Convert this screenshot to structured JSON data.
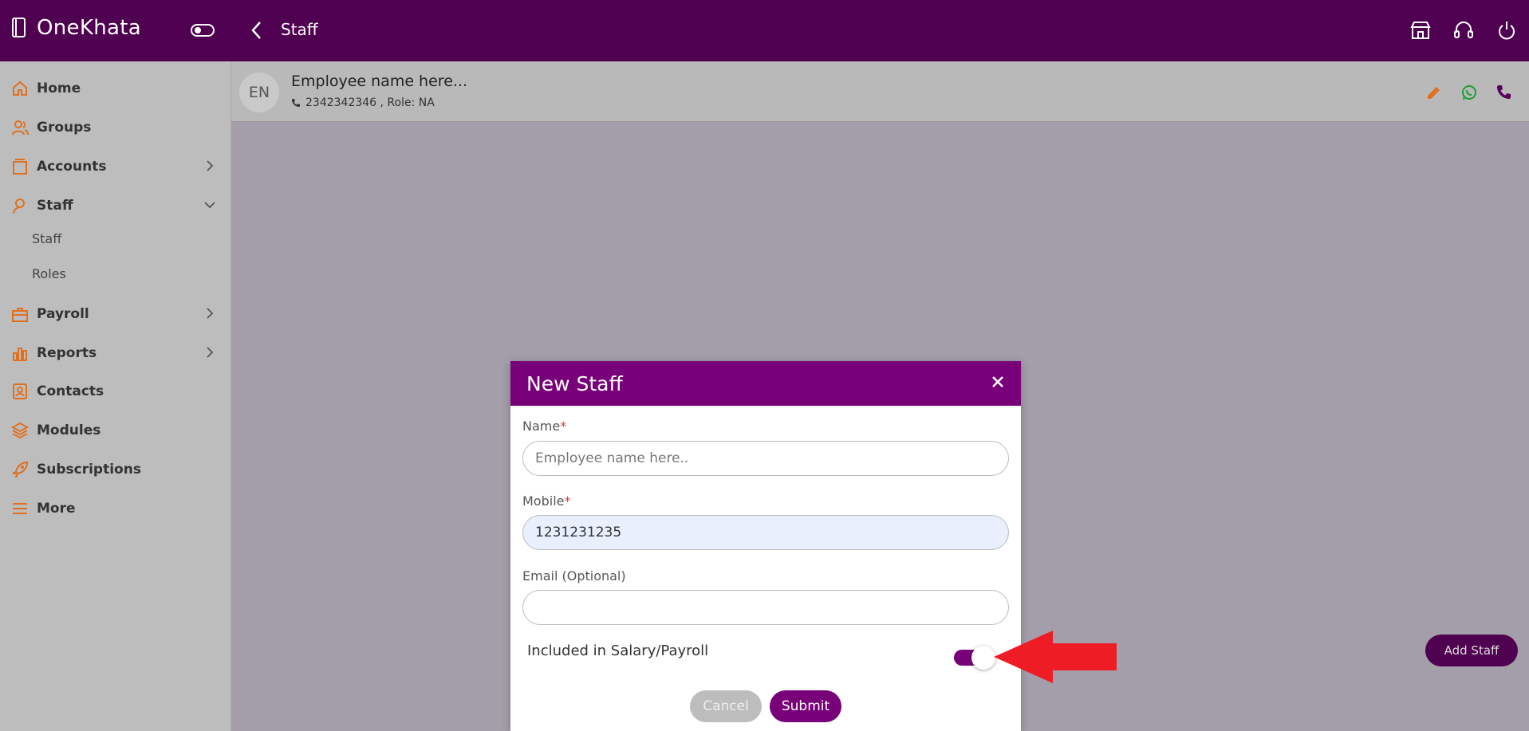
{
  "app": {
    "brand": "OneKhata",
    "page_title": "Staff"
  },
  "sidebar": {
    "items": [
      {
        "label": "Home",
        "icon": "home-icon"
      },
      {
        "label": "Groups",
        "icon": "groups-icon"
      },
      {
        "label": "Accounts",
        "icon": "accounts-icon"
      },
      {
        "label": "Staff",
        "icon": "staff-icon"
      },
      {
        "label": "Payroll",
        "icon": "payroll-icon"
      },
      {
        "label": "Reports",
        "icon": "reports-icon"
      },
      {
        "label": "Contacts",
        "icon": "contacts-icon"
      },
      {
        "label": "Modules",
        "icon": "modules-icon"
      },
      {
        "label": "Subscriptions",
        "icon": "rocket-icon"
      },
      {
        "label": "More",
        "icon": "menu-icon"
      }
    ],
    "staff_subitems": [
      "Staff",
      "Roles"
    ]
  },
  "employee": {
    "initials": "EN",
    "name": "Employee name here...",
    "meta": "2342342346 , Role: NA"
  },
  "add_staff_label": "Add Staff",
  "modal": {
    "title": "New Staff",
    "name_label": "Name",
    "name_placeholder": "Employee name here..",
    "mobile_label": "Mobile",
    "mobile_value": "1231231235",
    "email_label": "Email (Optional)",
    "email_value": "",
    "required_mark": "*",
    "payroll_toggle_label": "Included in Salary/Payroll",
    "payroll_toggle_on": true,
    "cancel_label": "Cancel",
    "submit_label": "Submit"
  },
  "colors": {
    "topbar": "#500050",
    "modal_header": "#780078",
    "sidebar_icon": "#e07020",
    "annotation_arrow": "#ee1c25"
  }
}
